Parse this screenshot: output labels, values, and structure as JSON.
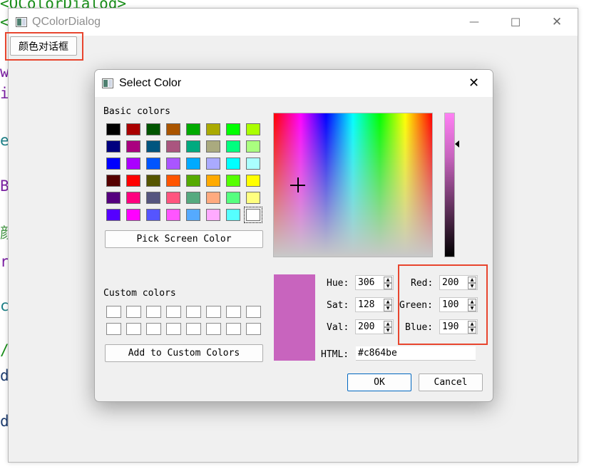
{
  "background_code": [
    {
      "text": "<QColorDialog>",
      "color": "#1a8f1a"
    },
    {
      "text": "<",
      "color": "#1a8f1a"
    },
    {
      "text": "w",
      "color": "#7a1fa2"
    },
    {
      "text": "i",
      "color": "#7a1fa2"
    },
    {
      "text": "e",
      "color": "#1c7f86"
    },
    {
      "text": "B",
      "color": "#7a1fa2"
    },
    {
      "text": "颜",
      "color": "#4a9a4a"
    },
    {
      "text": "r",
      "color": "#7a1fa2"
    },
    {
      "text": "c",
      "color": "#1c7f86"
    },
    {
      "text": "/",
      "color": "#1a8f1a"
    },
    {
      "text": "d",
      "color": "#1d3c6e"
    },
    {
      "text": "d",
      "color": "#1d3c6e"
    }
  ],
  "main_window": {
    "title": "QColorDialog",
    "open_button_label": "颜色对话框",
    "controls": {
      "minimize": "—",
      "maximize": "☐",
      "close": "✕"
    }
  },
  "dialog": {
    "title": "Select Color",
    "close": "✕",
    "basic_colors_label": "Basic colors",
    "basic_colors": [
      "#000000",
      "#aa0000",
      "#005500",
      "#aa5500",
      "#00aa00",
      "#aaaa00",
      "#00ff00",
      "#aaff00",
      "#00007f",
      "#aa007f",
      "#00557f",
      "#aa557f",
      "#00aa7f",
      "#aaaa7f",
      "#00ff7f",
      "#aaff7f",
      "#0000ff",
      "#aa00ff",
      "#0055ff",
      "#aa55ff",
      "#00aaff",
      "#aaaaff",
      "#00ffff",
      "#aaffff",
      "#550000",
      "#ff0000",
      "#555500",
      "#ff5500",
      "#55aa00",
      "#ffaa00",
      "#55ff00",
      "#ffff00",
      "#55007f",
      "#ff007f",
      "#55557f",
      "#ff557f",
      "#55aa7f",
      "#ffaa7f",
      "#55ff7f",
      "#ffff7f",
      "#5500ff",
      "#ff00ff",
      "#5555ff",
      "#ff55ff",
      "#55aaff",
      "#ffaaff",
      "#55ffff",
      "#ffffff"
    ],
    "pick_screen_label": "Pick Screen Color",
    "custom_colors_label": "Custom colors",
    "add_custom_label": "Add to Custom Colors",
    "preview_color": "#c864be",
    "hue_label": "Hue:",
    "hue": "306",
    "sat_label": "Sat:",
    "sat": "128",
    "val_label": "Val:",
    "val": "200",
    "red_label": "Red:",
    "red": "200",
    "green_label": "Green:",
    "green": "100",
    "blue_label": "Blue:",
    "blue": "190",
    "html_label": "HTML:",
    "html_value": "#c864be",
    "ok_label": "OK",
    "cancel_label": "Cancel"
  },
  "highlight_color": "#e8452e"
}
